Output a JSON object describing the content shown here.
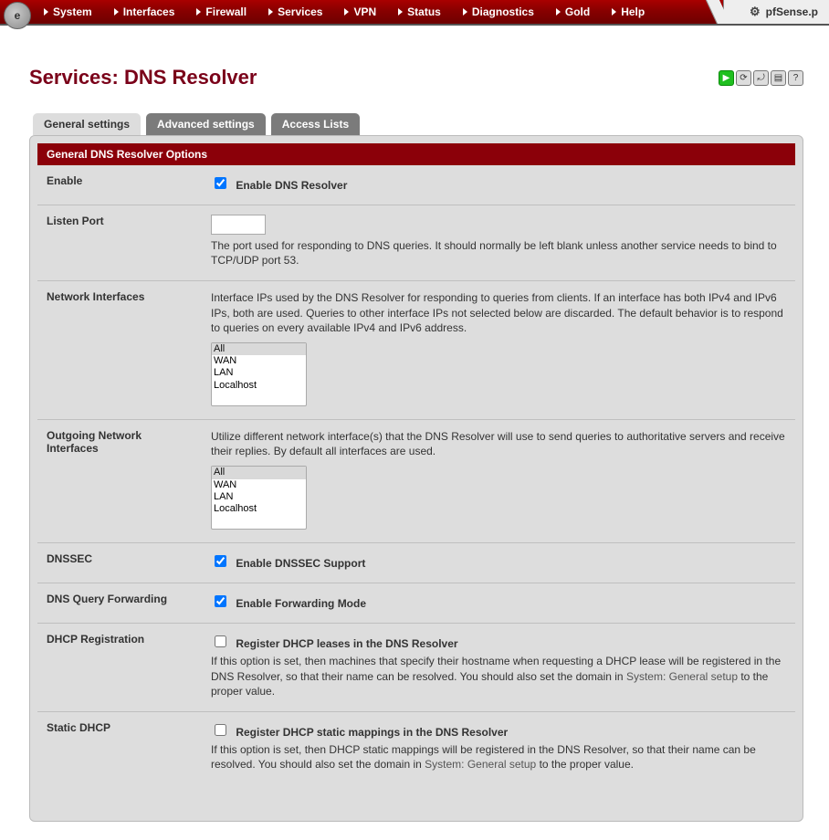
{
  "menu": {
    "items": [
      "System",
      "Interfaces",
      "Firewall",
      "Services",
      "VPN",
      "Status",
      "Diagnostics",
      "Gold",
      "Help"
    ]
  },
  "brand": {
    "label": "pfSense.p",
    "icon": "gear-icon"
  },
  "page": {
    "title": "Services: DNS Resolver"
  },
  "tabs": [
    {
      "label": "General settings",
      "active": true
    },
    {
      "label": "Advanced settings",
      "active": false
    },
    {
      "label": "Access Lists",
      "active": false
    }
  ],
  "section": {
    "header": "General DNS Resolver Options"
  },
  "fields": {
    "enable": {
      "label": "Enable",
      "checkbox_label": "Enable DNS Resolver",
      "checked": true
    },
    "listen_port": {
      "label": "Listen Port",
      "value": "",
      "desc": "The port used for responding to DNS queries. It should normally be left blank unless another service needs to bind to TCP/UDP port 53."
    },
    "network_interfaces": {
      "label": "Network Interfaces",
      "desc": "Interface IPs used by the DNS Resolver for responding to queries from clients. If an interface has both IPv4 and IPv6 IPs, both are used. Queries to other interface IPs not selected below are discarded. The default behavior is to respond to queries on every available IPv4 and IPv6 address.",
      "options": [
        "All",
        "WAN",
        "LAN",
        "Localhost"
      ],
      "selected": [
        "All"
      ]
    },
    "outgoing_interfaces": {
      "label": "Outgoing Network Interfaces",
      "desc": "Utilize different network interface(s) that the DNS Resolver will use to send queries to authoritative servers and receive their replies. By default all interfaces are used.",
      "options": [
        "All",
        "WAN",
        "LAN",
        "Localhost"
      ],
      "selected": [
        "All"
      ]
    },
    "dnssec": {
      "label": "DNSSEC",
      "checkbox_label": "Enable DNSSEC Support",
      "checked": true
    },
    "dns_query_forwarding": {
      "label": "DNS Query Forwarding",
      "checkbox_label": "Enable Forwarding Mode",
      "checked": true
    },
    "dhcp_registration": {
      "label": "DHCP Registration",
      "checkbox_label": "Register DHCP leases in the DNS Resolver",
      "checked": false,
      "desc_pre": "If this option is set, then machines that specify their hostname when requesting a DHCP lease will be registered in the DNS Resolver, so that their name can be resolved. You should also set the domain in ",
      "link": "System: General setup",
      "desc_post": " to the proper value."
    },
    "static_dhcp": {
      "label": "Static DHCP",
      "checkbox_label": "Register DHCP static mappings in the DNS Resolver",
      "checked": false,
      "desc_pre": "If this option is set, then DHCP static mappings will be registered in the DNS Resolver, so that their name can be resolved. You should also set the domain in ",
      "link": "System: General setup",
      "desc_post": " to the proper value."
    }
  },
  "topicons": [
    "play",
    "reload",
    "refresh",
    "page",
    "help"
  ]
}
